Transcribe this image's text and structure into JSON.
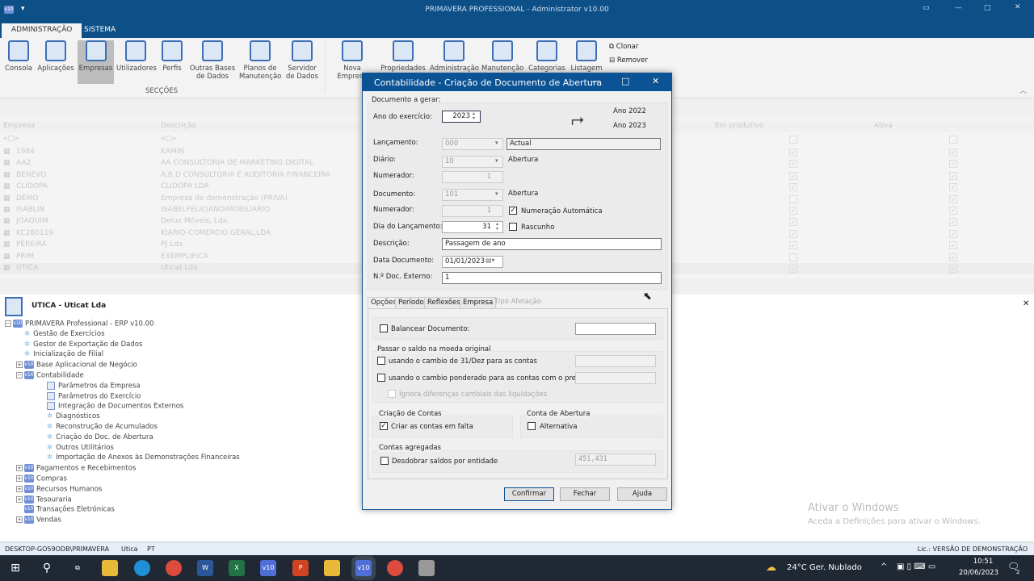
{
  "window": {
    "title": "PRIMAVERA PROFESSIONAL - Administrator v10.00",
    "logo": "v10"
  },
  "ribbon": {
    "tabs": [
      "ADMINISTRAÇÃO",
      "SISTEMA"
    ],
    "section_buttons": [
      {
        "label": "Consola"
      },
      {
        "label": "Aplicações"
      },
      {
        "label": "Empresas"
      },
      {
        "label": "Utilizadores"
      },
      {
        "label": "Perfis"
      },
      {
        "label": "Outras Bases de Dados"
      },
      {
        "label": "Planos de Manutenção"
      },
      {
        "label": "Servidor de Dados"
      }
    ],
    "section_label": "SECÇÕES",
    "company_buttons": [
      {
        "label": "Nova Empresa"
      },
      {
        "label": "Propriedades"
      },
      {
        "label": "Administração"
      },
      {
        "label": "Manutenção"
      },
      {
        "label": "Categorias"
      },
      {
        "label": "Listagem"
      }
    ],
    "small_buttons": [
      "Clonar",
      "Remover"
    ]
  },
  "grid": {
    "columns": [
      "Empresa",
      "Descrição",
      "Em produtivo",
      "Ativa"
    ],
    "filter_placeholder": "«□»",
    "rows": [
      {
        "code": "1984",
        "desc": "KAMIN",
        "prod": true,
        "ativa": true
      },
      {
        "code": "AA2",
        "desc": "AA CONSULTORIA DE MARKETING DIGITAL",
        "prod": true,
        "ativa": true
      },
      {
        "code": "BENEVO",
        "desc": "A.B.D CONSULTÓRIA E AUDITORIA FINANCEIRA",
        "prod": true,
        "ativa": true
      },
      {
        "code": "CLIDOPA",
        "desc": "CLIDOPA LDA",
        "prod": true,
        "ativa": true
      },
      {
        "code": "DEMO",
        "desc": "Empresa de demonstração (PRIVA)",
        "prod": false,
        "ativa": true
      },
      {
        "code": "ISABLIN",
        "desc": "ISABELFELICIANOIMOBILIARIO",
        "prod": true,
        "ativa": true
      },
      {
        "code": "JOAQUIM",
        "desc": "Delux Móveis, Lda.",
        "prod": true,
        "ativa": true
      },
      {
        "code": "KC280119",
        "desc": "KIARIO-COMERCIO GERAL,LDA",
        "prod": true,
        "ativa": true
      },
      {
        "code": "PEREIRA",
        "desc": "PJ Lda",
        "prod": true,
        "ativa": true
      },
      {
        "code": "PRIM",
        "desc": "EXEMPLIFICA",
        "prod": false,
        "ativa": true
      },
      {
        "code": "UTICA",
        "desc": "Uticat Lda",
        "prod": true,
        "ativa": true
      }
    ]
  },
  "company_panel": {
    "title": "UTICA - Uticat Lda",
    "tree": [
      {
        "level": 0,
        "type": "v10",
        "exp": "-",
        "label": "PRIMAVERA Professional - ERP v10.00"
      },
      {
        "level": 1,
        "type": "gear",
        "label": "Gestão de Exercícios"
      },
      {
        "level": 1,
        "type": "gear",
        "label": "Gestor de Exportação de Dados"
      },
      {
        "level": 1,
        "type": "gear",
        "label": "Inicialização de Filial"
      },
      {
        "level": 1,
        "type": "v10",
        "exp": "+",
        "label": "Base Aplicacional de Negócio"
      },
      {
        "level": 1,
        "type": "v10",
        "exp": "-",
        "label": "Contabilidade"
      },
      {
        "level": 2,
        "type": "doc",
        "label": "Parâmetros da Empresa"
      },
      {
        "level": 2,
        "type": "doc",
        "label": "Parâmetros do Exercício"
      },
      {
        "level": 2,
        "type": "doc",
        "label": "Integração de Documentos Externos"
      },
      {
        "level": 2,
        "type": "gear",
        "label": "Diagnósticos"
      },
      {
        "level": 2,
        "type": "gear",
        "label": "Reconstrução de Acumulados"
      },
      {
        "level": 2,
        "type": "gear",
        "label": "Criação do Doc. de Abertura"
      },
      {
        "level": 2,
        "type": "gear",
        "label": "Outros Utilitários"
      },
      {
        "level": 2,
        "type": "gear",
        "label": "Importação de Anexos às Demonstrações Financeiras"
      },
      {
        "level": 1,
        "type": "v10",
        "exp": "+",
        "label": "Pagamentos e Recebimentos"
      },
      {
        "level": 1,
        "type": "v10",
        "exp": "+",
        "label": "Compras"
      },
      {
        "level": 1,
        "type": "v10",
        "exp": "+",
        "label": "Recursos Humanos"
      },
      {
        "level": 1,
        "type": "v10",
        "exp": "+",
        "label": "Tesouraria"
      },
      {
        "level": 1,
        "type": "v10",
        "exp": "",
        "label": "Transações Eletrónicas"
      },
      {
        "level": 1,
        "type": "v10",
        "exp": "+",
        "label": "Vendas"
      }
    ]
  },
  "dialog": {
    "title": "Contabilidade - Criação de Documento de Abertura",
    "group_label": "Documento a gerar:",
    "ano_label": "Ano do exercício:",
    "ano_value": "2023",
    "year_from": "Ano 2022",
    "year_to": "Ano 2023",
    "lancamento_label": "Lançamento:",
    "lancamento_value": "000",
    "lancamento_desc": "Actual",
    "diario_label": "Diário:",
    "diario_value": "10",
    "diario_desc": "Abertura",
    "numerador1_label": "Numerador:",
    "numerador1_value": "1",
    "documento_label": "Documento:",
    "documento_value": "101",
    "documento_desc": "Abertura",
    "numerador2_label": "Numerador:",
    "numerador2_value": "1",
    "numeracao_auto_label": "Numeração Automática",
    "numeracao_auto_checked": true,
    "dia_label": "Dia do Lançamento:",
    "dia_value": "31",
    "rascunho_label": "Rascunho",
    "rascunho_checked": false,
    "descricao_label": "Descrição:",
    "descricao_value": "Passagem de ano",
    "data_label": "Data Documento:",
    "data_value": "01/01/2023",
    "docext_label": "N.º Doc. Externo:",
    "docext_value": "1",
    "tabs": [
      "Opções",
      "Período",
      "Reflexões",
      "Empresa",
      "Tipo Afetação"
    ],
    "balancear_label": "Balancear Documento:",
    "moeda_group": "Passar o saldo na moeda original",
    "cambio_dez_label": "usando o cambio de 31/Dez para as contas",
    "cambio_pond_label": "usando o cambio ponderado para as contas com o prefixo:",
    "ignora_label": "Ignora diferenças cambiais das liquidações",
    "criacao_group": "Criação de Contas",
    "criar_label": "Criar as contas em falta",
    "criar_checked": true,
    "conta_ab_group": "Conta de Abertura",
    "alternativa_label": "Alternativa",
    "agregadas_group": "Contas agregadas",
    "desdobrar_label": "Desdobrar saldos por entidade",
    "desdobrar_value": "451,431",
    "buttons": {
      "confirm": "Confirmar",
      "close": "Fechar",
      "help": "Ajuda"
    }
  },
  "watermark": {
    "title": "Ativar o Windows",
    "subtitle": "Aceda a Definições para ativar o Windows."
  },
  "statusbar": {
    "server": "DESKTOP-GO59ODB\\PRIMAVERA",
    "company": "Utica",
    "lang": "PT",
    "license": "Lic.: VERSÃO DE DEMONSTRAÇÃO"
  },
  "taskbar": {
    "weather": "24°C  Ger. Nublado",
    "time": "10:51",
    "date": "20/06/2023",
    "notifications": "2"
  },
  "colors": {
    "brand": "#0d4f87",
    "dialog_title": "#0b5394"
  }
}
